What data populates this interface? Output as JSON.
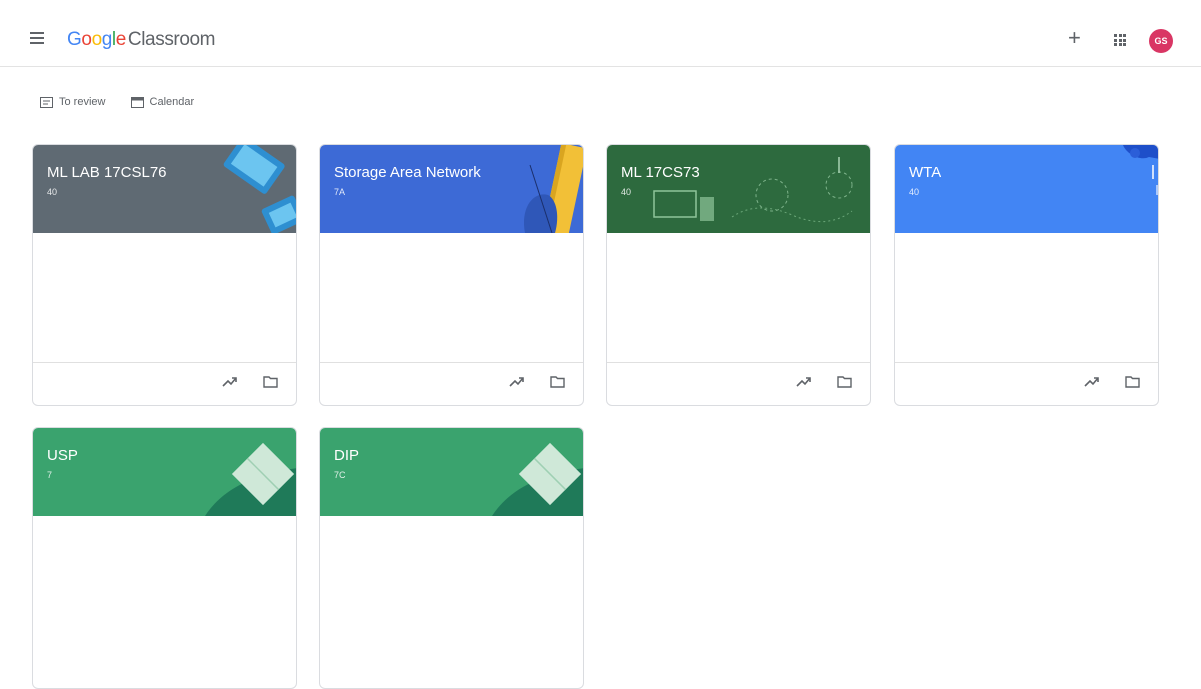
{
  "app": {
    "logo_letters": [
      "G",
      "o",
      "o",
      "g",
      "l",
      "e"
    ],
    "product_name": "Classroom",
    "add_symbol": "+",
    "avatar_initials": "GS"
  },
  "subnav": {
    "todo_label": "To review",
    "calendar_label": "Calendar"
  },
  "courses": [
    {
      "title": "ML LAB 17CSL76",
      "section": "40",
      "theme": "gray",
      "color": "#5f6a73"
    },
    {
      "title": "Storage Area Network",
      "section": "7A",
      "theme": "blue-books",
      "color": "#3d6ad6"
    },
    {
      "title": "ML 17CS73",
      "section": "40",
      "theme": "chalkboard",
      "color": "#2d6a3e"
    },
    {
      "title": "WTA",
      "section": "40",
      "theme": "blue",
      "color": "#4285f4"
    },
    {
      "title": "USP",
      "section": "7",
      "theme": "green-diamond",
      "color": "#3aa36e"
    },
    {
      "title": "DIP",
      "section": "7C",
      "theme": "green-diamond",
      "color": "#3aa36e"
    }
  ],
  "icons": {
    "menu": "hamburger-menu-icon",
    "add": "plus-icon",
    "apps": "apps-grid-icon",
    "todo": "assignment-icon",
    "calendar": "calendar-icon",
    "trend": "trending-up-icon",
    "folder": "folder-icon"
  }
}
